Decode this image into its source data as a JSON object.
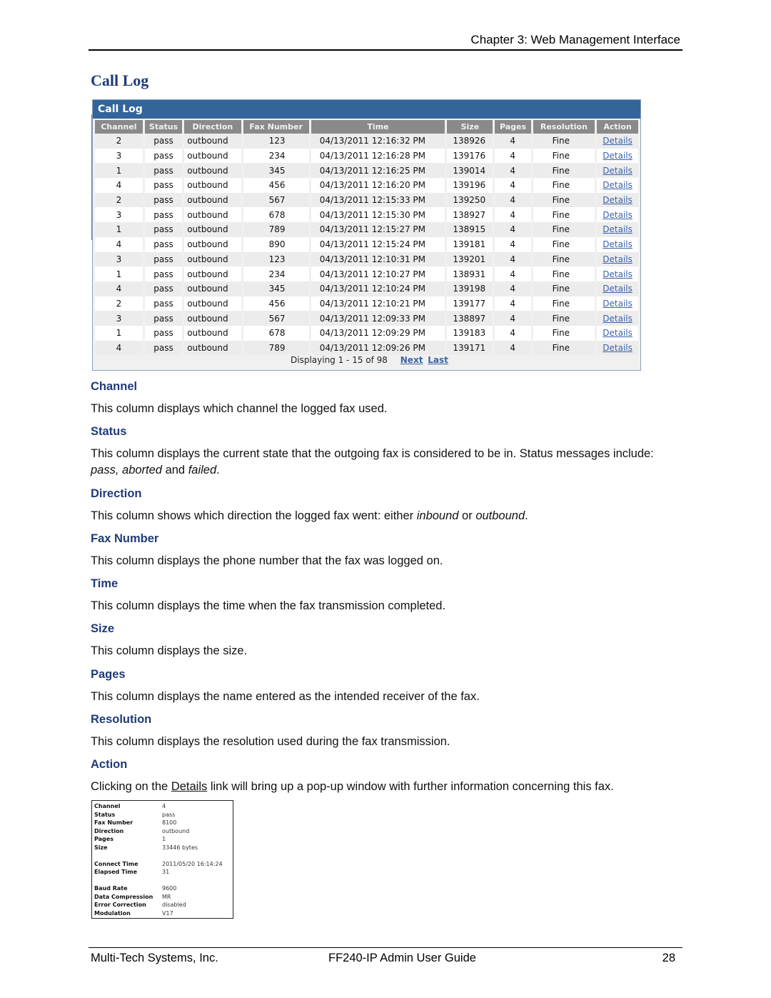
{
  "header": {
    "chapter": "Chapter 3: Web Management Interface"
  },
  "section_title": "Call Log",
  "call_log": {
    "title": "Call Log",
    "columns": [
      "Channel",
      "Status",
      "Direction",
      "Fax Number",
      "Time",
      "Size",
      "Pages",
      "Resolution",
      "Action"
    ],
    "rows": [
      {
        "channel": "2",
        "status": "pass",
        "direction": "outbound",
        "fax_number": "123",
        "time": "04/13/2011 12:16:32 PM",
        "size": "138926",
        "pages": "4",
        "resolution": "Fine",
        "action": "Details"
      },
      {
        "channel": "3",
        "status": "pass",
        "direction": "outbound",
        "fax_number": "234",
        "time": "04/13/2011 12:16:28 PM",
        "size": "139176",
        "pages": "4",
        "resolution": "Fine",
        "action": "Details"
      },
      {
        "channel": "1",
        "status": "pass",
        "direction": "outbound",
        "fax_number": "345",
        "time": "04/13/2011 12:16:25 PM",
        "size": "139014",
        "pages": "4",
        "resolution": "Fine",
        "action": "Details"
      },
      {
        "channel": "4",
        "status": "pass",
        "direction": "outbound",
        "fax_number": "456",
        "time": "04/13/2011 12:16:20 PM",
        "size": "139196",
        "pages": "4",
        "resolution": "Fine",
        "action": "Details"
      },
      {
        "channel": "2",
        "status": "pass",
        "direction": "outbound",
        "fax_number": "567",
        "time": "04/13/2011 12:15:33 PM",
        "size": "139250",
        "pages": "4",
        "resolution": "Fine",
        "action": "Details"
      },
      {
        "channel": "3",
        "status": "pass",
        "direction": "outbound",
        "fax_number": "678",
        "time": "04/13/2011 12:15:30 PM",
        "size": "138927",
        "pages": "4",
        "resolution": "Fine",
        "action": "Details"
      },
      {
        "channel": "1",
        "status": "pass",
        "direction": "outbound",
        "fax_number": "789",
        "time": "04/13/2011 12:15:27 PM",
        "size": "138915",
        "pages": "4",
        "resolution": "Fine",
        "action": "Details"
      },
      {
        "channel": "4",
        "status": "pass",
        "direction": "outbound",
        "fax_number": "890",
        "time": "04/13/2011 12:15:24 PM",
        "size": "139181",
        "pages": "4",
        "resolution": "Fine",
        "action": "Details"
      },
      {
        "channel": "3",
        "status": "pass",
        "direction": "outbound",
        "fax_number": "123",
        "time": "04/13/2011 12:10:31 PM",
        "size": "139201",
        "pages": "4",
        "resolution": "Fine",
        "action": "Details"
      },
      {
        "channel": "1",
        "status": "pass",
        "direction": "outbound",
        "fax_number": "234",
        "time": "04/13/2011 12:10:27 PM",
        "size": "138931",
        "pages": "4",
        "resolution": "Fine",
        "action": "Details"
      },
      {
        "channel": "4",
        "status": "pass",
        "direction": "outbound",
        "fax_number": "345",
        "time": "04/13/2011 12:10:24 PM",
        "size": "139198",
        "pages": "4",
        "resolution": "Fine",
        "action": "Details"
      },
      {
        "channel": "2",
        "status": "pass",
        "direction": "outbound",
        "fax_number": "456",
        "time": "04/13/2011 12:10:21 PM",
        "size": "139177",
        "pages": "4",
        "resolution": "Fine",
        "action": "Details"
      },
      {
        "channel": "3",
        "status": "pass",
        "direction": "outbound",
        "fax_number": "567",
        "time": "04/13/2011 12:09:33 PM",
        "size": "138897",
        "pages": "4",
        "resolution": "Fine",
        "action": "Details"
      },
      {
        "channel": "1",
        "status": "pass",
        "direction": "outbound",
        "fax_number": "678",
        "time": "04/13/2011 12:09:29 PM",
        "size": "139183",
        "pages": "4",
        "resolution": "Fine",
        "action": "Details"
      },
      {
        "channel": "4",
        "status": "pass",
        "direction": "outbound",
        "fax_number": "789",
        "time": "04/13/2011 12:09:26 PM",
        "size": "139171",
        "pages": "4",
        "resolution": "Fine",
        "action": "Details"
      }
    ],
    "pager": {
      "text": "Displaying 1 - 15 of 98",
      "next": "Next",
      "last": "Last"
    }
  },
  "descriptions": [
    {
      "heading": "Channel",
      "text": "This column displays which channel the logged fax used."
    },
    {
      "heading": "Status",
      "text_parts": [
        "This column displays the current state that the outgoing fax is considered to be in. Status messages include: ",
        "pass, aborted",
        " and ",
        "failed",
        "."
      ]
    },
    {
      "heading": "Direction",
      "text_parts": [
        "This column shows which direction the logged fax went: either ",
        "inbound",
        " or ",
        "outbound",
        "."
      ]
    },
    {
      "heading": "Fax Number",
      "text": "This column displays the phone number that the fax was logged on."
    },
    {
      "heading": "Time",
      "text": "This column displays the time when the fax transmission completed."
    },
    {
      "heading": "Size",
      "text": "This column displays the size."
    },
    {
      "heading": "Pages",
      "text": "This column displays the name entered as the intended receiver of the fax."
    },
    {
      "heading": "Resolution",
      "text": "This column displays the resolution used during the fax transmission."
    },
    {
      "heading": "Action",
      "text_parts": [
        "Clicking on the ",
        "Details",
        " link will bring up a pop-up window with further information concerning this fax."
      ]
    }
  ],
  "details_popup": {
    "groups": [
      [
        {
          "key": "Channel",
          "value": "4"
        },
        {
          "key": "Status",
          "value": "pass"
        },
        {
          "key": "Fax Number",
          "value": "8100"
        },
        {
          "key": "Direction",
          "value": "outbound"
        },
        {
          "key": "Pages",
          "value": "1"
        },
        {
          "key": "Size",
          "value": "33446 bytes"
        }
      ],
      [
        {
          "key": "Connect Time",
          "value": "2011/05/20 16:14:24"
        },
        {
          "key": "Elapsed Time",
          "value": "31"
        }
      ],
      [
        {
          "key": "Baud Rate",
          "value": "9600"
        },
        {
          "key": "Data Compression",
          "value": "MR"
        },
        {
          "key": "Error Correction",
          "value": "disabled"
        },
        {
          "key": "Modulation",
          "value": "V17"
        }
      ]
    ]
  },
  "footer": {
    "company": "Multi-Tech Systems, Inc.",
    "guide": "FF240-IP Admin User Guide",
    "page": "28"
  }
}
